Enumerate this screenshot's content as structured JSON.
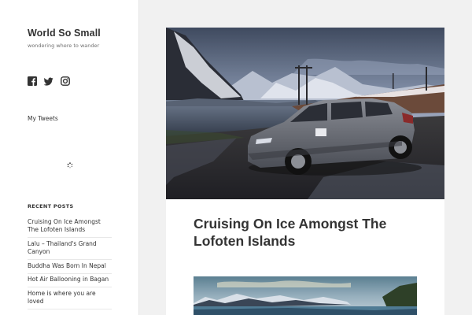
{
  "site": {
    "title": "World So Small",
    "description": "wondering where to wander"
  },
  "social": [
    {
      "name": "facebook-icon"
    },
    {
      "name": "twitter-icon"
    },
    {
      "name": "instagram-icon"
    }
  ],
  "widgets": {
    "tweets_label": "My Tweets",
    "recent_posts_title": "RECENT POSTS",
    "recent_posts": [
      "Cruising On Ice Amongst The Lofoten Islands",
      "Lalu – Thailand's Grand Canyon",
      "Buddha Was Born In Nepal",
      "Hot Air Ballooning in Bagan",
      "Home is where you are loved"
    ]
  },
  "post": {
    "title": "Cruising On Ice Amongst The Lofoten Islands"
  },
  "colors": {
    "background": "#f1f1f1",
    "sidebar": "#ffffff",
    "text": "#333333"
  }
}
